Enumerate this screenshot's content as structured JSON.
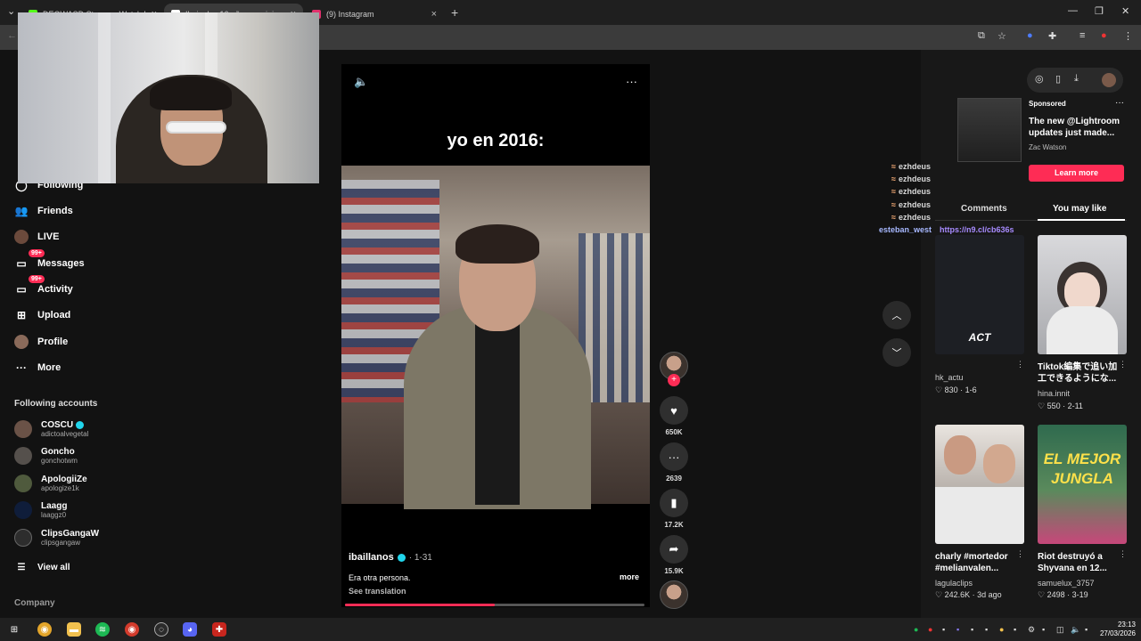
{
  "browser": {
    "tabs": [
      {
        "title": "DEOWASD Stream - Watch Live",
        "color": "#53fc18"
      },
      {
        "title": "Ibai a los 16 años un viaje",
        "color": "#ffffff"
      },
      {
        "title": "(9) Instagram",
        "color": "#e1306c"
      }
    ],
    "new_tab": "+"
  },
  "sidebar": {
    "nav": [
      {
        "label": "Following",
        "icon": "following-icon"
      },
      {
        "label": "Friends",
        "icon": "friends-icon"
      },
      {
        "label": "LIVE",
        "icon": "live-icon"
      },
      {
        "label": "Messages",
        "icon": "messages-icon",
        "badge": "99+"
      },
      {
        "label": "Activity",
        "icon": "activity-icon",
        "badge": "99+"
      },
      {
        "label": "Upload",
        "icon": "upload-icon"
      },
      {
        "label": "Profile",
        "icon": "profile-icon"
      },
      {
        "label": "More",
        "icon": "more-icon"
      }
    ],
    "following_title": "Following accounts",
    "accounts": [
      {
        "name": "COSCU",
        "handle": "adictoalvegetal",
        "verified": true
      },
      {
        "name": "Goncho",
        "handle": "gonchotwm"
      },
      {
        "name": "ApologiiZe",
        "handle": "apologize1k"
      },
      {
        "name": "Laagg",
        "handle": "laaggz0"
      },
      {
        "name": "ClipsGangaW",
        "handle": "clipsgangaw"
      }
    ],
    "view_all": "View all",
    "company": "Company"
  },
  "video": {
    "overlay_text": "yo en 2016:",
    "author": "ibaillanos",
    "date": "· 1-31",
    "description": "Era otra persona.",
    "more": "more",
    "see_translation": "See translation",
    "progress": 0.5
  },
  "actions": {
    "likes": "650K",
    "comments": "2639",
    "saves": "17.2K",
    "shares": "15.9K"
  },
  "ad": {
    "label": "Sponsored",
    "title": "The new @Lightroom updates just made...",
    "author": "Zac Watson",
    "cta": "Learn more"
  },
  "panel_tabs": {
    "comments": "Comments",
    "you_may_like": "You may like"
  },
  "chat": {
    "messages": [
      "ezhdeus",
      "ezhdeus",
      "ezhdeus",
      "ezhdeus",
      "ezhdeus"
    ],
    "last_name": "esteban_west",
    "last_link": "https://n9.cl/cb636s"
  },
  "cards": [
    {
      "title": "",
      "thumb_text": "ACT",
      "author": "hk_actu",
      "stats": "♡ 830 · 1-6"
    },
    {
      "title": "Tiktok編集で追い加工できるようにな...",
      "author": "hina.innit",
      "stats": "♡ 550 · 2-11"
    },
    {
      "title": "charly #mortedor #melianvalen...",
      "author": "lagulaclips",
      "stats": "♡ 242.6K · 3d ago"
    },
    {
      "title": "Riot destruyó a Shyvana en 12...",
      "thumb_text": "EL MEJOR JUNGLA",
      "author": "samuelux_3757",
      "stats": "♡ 2498 · 3-19"
    }
  ],
  "taskbar": {
    "time": "23:13",
    "date": "27/03/2026"
  }
}
